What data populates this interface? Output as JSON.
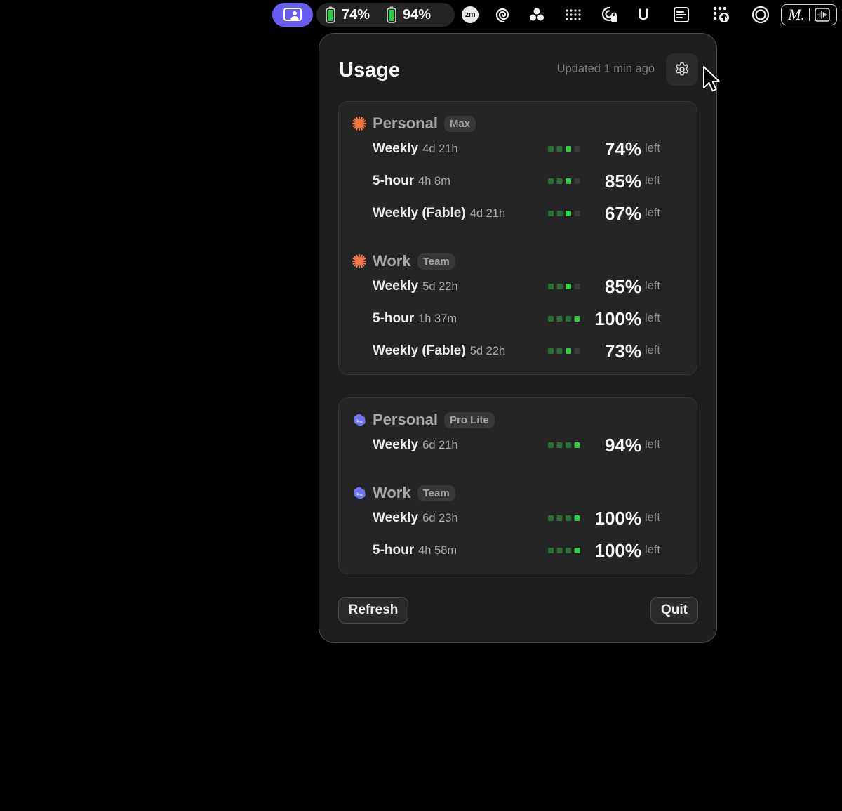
{
  "menubar": {
    "battery1_pct": "74%",
    "battery2_pct": "94%",
    "zoom_label": "zm",
    "u_label": "U",
    "m_label": "M."
  },
  "colors": {
    "accent_purple": "#6a5df4",
    "bar_on": "#39c94e",
    "bar_dim": "#2b6e36",
    "bar_off": "#3a3a3a",
    "anthropic_orange": "#e8774f",
    "codex_blue": "#6f73f0"
  },
  "panel": {
    "title": "Usage",
    "updated": "Updated 1 min ago",
    "settings_icon": "gear-icon",
    "refresh_label": "Refresh",
    "quit_label": "Quit",
    "left_word": "left"
  },
  "cards": [
    {
      "provider_icon": "burst-icon",
      "groups": [
        {
          "name": "Personal",
          "badge": "Max",
          "rows": [
            {
              "label": "Weekly",
              "time": "4d 21h",
              "pct_text": "74%",
              "pct": 74
            },
            {
              "label": "5-hour",
              "time": "4h 8m",
              "pct_text": "85%",
              "pct": 85
            },
            {
              "label": "Weekly (Fable)",
              "time": "4d 21h",
              "pct_text": "67%",
              "pct": 67
            }
          ]
        },
        {
          "name": "Work",
          "badge": "Team",
          "rows": [
            {
              "label": "Weekly",
              "time": "5d 22h",
              "pct_text": "85%",
              "pct": 85
            },
            {
              "label": "5-hour",
              "time": "1h 37m",
              "pct_text": "100%",
              "pct": 100
            },
            {
              "label": "Weekly (Fable)",
              "time": "5d 22h",
              "pct_text": "73%",
              "pct": 73
            }
          ]
        }
      ]
    },
    {
      "provider_icon": "cloud-blob-icon",
      "groups": [
        {
          "name": "Personal",
          "badge": "Pro Lite",
          "rows": [
            {
              "label": "Weekly",
              "time": "6d 21h",
              "pct_text": "94%",
              "pct": 94
            }
          ]
        },
        {
          "name": "Work",
          "badge": "Team",
          "rows": [
            {
              "label": "Weekly",
              "time": "6d 23h",
              "pct_text": "100%",
              "pct": 100
            },
            {
              "label": "5-hour",
              "time": "4h 58m",
              "pct_text": "100%",
              "pct": 100
            }
          ]
        }
      ]
    }
  ]
}
